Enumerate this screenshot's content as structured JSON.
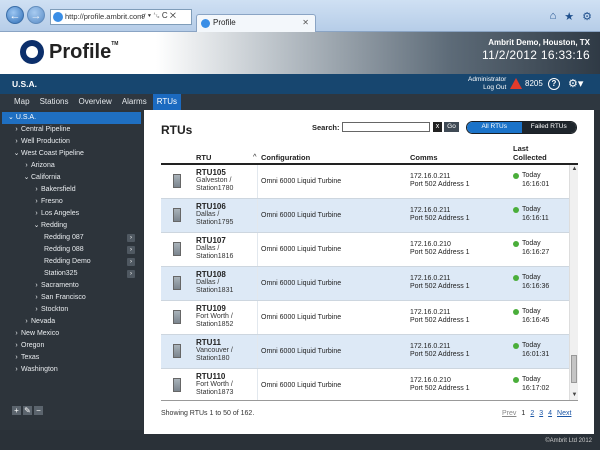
{
  "browser": {
    "url": "http://profile.ambrit.com/",
    "url_actions": "⌕ ▾ ␂ C ✕",
    "tab_title": "Profile"
  },
  "header": {
    "logo_text": "Profile",
    "logo_tm": "TM",
    "company": "Ambrit Demo, Houston, TX",
    "datetime": "11/2/2012  16:33:16"
  },
  "bluebar": {
    "location": "U.S.A.",
    "user": "Administrator",
    "logout": "Log Out",
    "alarm_count": "8205",
    "help": "?",
    "gear": "⚙▾"
  },
  "nav": {
    "tabs": [
      "Map",
      "Stations",
      "Overview",
      "Alarms",
      "RTUs"
    ],
    "active": "RTUs"
  },
  "sidebar": {
    "root": "U.S.A.",
    "items": [
      {
        "arrow": "›",
        "label": "Central Pipeline",
        "indent": 0
      },
      {
        "arrow": "›",
        "label": "Well Production",
        "indent": 0
      },
      {
        "arrow": "⌄",
        "label": "West Coast Pipeline",
        "indent": 0
      },
      {
        "arrow": "›",
        "label": "Arizona",
        "indent": 1
      },
      {
        "arrow": "⌄",
        "label": "California",
        "indent": 1
      },
      {
        "arrow": "›",
        "label": "Bakersfield",
        "indent": 2
      },
      {
        "arrow": "›",
        "label": "Fresno",
        "indent": 2
      },
      {
        "arrow": "›",
        "label": "Los Angeles",
        "indent": 2
      },
      {
        "arrow": "⌄",
        "label": "Redding",
        "indent": 2
      }
    ],
    "stations": [
      "Redding 087",
      "Redding 088",
      "Redding Demo",
      "Station325"
    ],
    "items_after": [
      {
        "arrow": "›",
        "label": "Sacramento",
        "indent": 2
      },
      {
        "arrow": "›",
        "label": "San Francisco",
        "indent": 2
      },
      {
        "arrow": "›",
        "label": "Stockton",
        "indent": 2
      },
      {
        "arrow": "›",
        "label": "Nevada",
        "indent": 1
      },
      {
        "arrow": "›",
        "label": "New Mexico",
        "indent": 0
      },
      {
        "arrow": "›",
        "label": "Oregon",
        "indent": 0
      },
      {
        "arrow": "›",
        "label": "Texas",
        "indent": 0
      },
      {
        "arrow": "›",
        "label": "Washington",
        "indent": 0
      }
    ],
    "tools": [
      "+",
      "✎",
      "−"
    ]
  },
  "main": {
    "title": "RTUs",
    "search_label": "Search:",
    "search_value": "",
    "clear": "x",
    "go": "Go",
    "toggle_all": "All RTUs",
    "toggle_failed": "Failed RTUs",
    "columns": {
      "rtu": "RTU",
      "sort": "^",
      "config": "Configuration",
      "comms": "Comms",
      "last": "Last",
      "collected": "Collected"
    },
    "rows": [
      {
        "name": "RTU105",
        "loc1": "Galveston /",
        "loc2": "Station1780",
        "config": "Omni 6000 Liquid Turbine",
        "ip": "172.16.0.211",
        "port": "Port 502 Address 1",
        "day": "Today",
        "time": "16:16:01"
      },
      {
        "name": "RTU106",
        "loc1": "Dallas /",
        "loc2": "Station1795",
        "config": "Omni 6000 Liquid Turbine",
        "ip": "172.16.0.211",
        "port": "Port 502 Address 1",
        "day": "Today",
        "time": "16:16:11"
      },
      {
        "name": "RTU107",
        "loc1": "Dallas /",
        "loc2": "Station1816",
        "config": "Omni 6000 Liquid Turbine",
        "ip": "172.16.0.210",
        "port": "Port 502 Address 1",
        "day": "Today",
        "time": "16:16:27"
      },
      {
        "name": "RTU108",
        "loc1": "Dallas /",
        "loc2": "Station1831",
        "config": "Omni 6000 Liquid Turbine",
        "ip": "172.16.0.211",
        "port": "Port 502 Address 1",
        "day": "Today",
        "time": "16:16:36"
      },
      {
        "name": "RTU109",
        "loc1": "Fort Worth /",
        "loc2": "Station1852",
        "config": "Omni 6000 Liquid Turbine",
        "ip": "172.16.0.211",
        "port": "Port 502 Address 1",
        "day": "Today",
        "time": "16:16:45"
      },
      {
        "name": "RTU11",
        "loc1": "Vancouver /",
        "loc2": "Station180",
        "config": "Omni 6000 Liquid Turbine",
        "ip": "172.16.0.211",
        "port": "Port 502 Address 1",
        "day": "Today",
        "time": "16:01:31"
      },
      {
        "name": "RTU110",
        "loc1": "Fort Worth /",
        "loc2": "Station1873",
        "config": "Omni 6000 Liquid Turbine",
        "ip": "172.16.0.210",
        "port": "Port 502 Address 1",
        "day": "Today",
        "time": "16:17:02"
      }
    ],
    "showing": "Showing RTUs 1 to 50 of 162.",
    "pager": {
      "prev": "Prev",
      "pages": [
        "1",
        "2",
        "3",
        "4"
      ],
      "current": "1",
      "next": "Next"
    }
  },
  "copyright": "©Ambrit Ltd 2012"
}
